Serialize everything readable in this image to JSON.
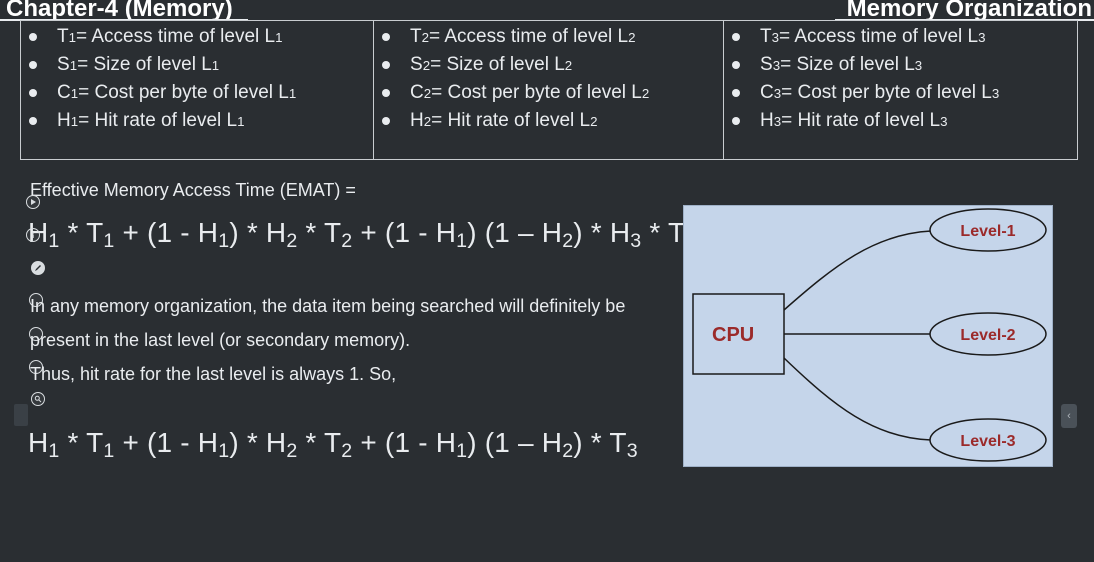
{
  "header": {
    "title_left": "Chapter-4 (Memory)",
    "title_right": "Memory Organization"
  },
  "definitions": [
    {
      "level": "1",
      "items": [
        {
          "sym": "T",
          "sub": "1",
          "text": " = Access time of level L",
          "lsub": "1"
        },
        {
          "sym": "S",
          "sub": "1",
          "text": " = Size of level L",
          "lsub": "1"
        },
        {
          "sym": "C",
          "sub": "1",
          "text": " = Cost per byte of level L",
          "lsub": "1"
        },
        {
          "sym": "H",
          "sub": "1",
          "text": " = Hit rate of level L",
          "lsub": "1"
        }
      ]
    },
    {
      "level": "2",
      "items": [
        {
          "sym": "T",
          "sub": "2",
          "text": " = Access time of level L",
          "lsub": "2"
        },
        {
          "sym": "S",
          "sub": "2",
          "text": " = Size of level L",
          "lsub": "2"
        },
        {
          "sym": "C",
          "sub": "2",
          "text": " = Cost per byte of level L",
          "lsub": "2"
        },
        {
          "sym": "H",
          "sub": "2",
          "text": " = Hit rate of level L",
          "lsub": "2"
        }
      ]
    },
    {
      "level": "3",
      "items": [
        {
          "sym": "T",
          "sub": "3",
          "text": " = Access time of level L",
          "lsub": "3"
        },
        {
          "sym": "S",
          "sub": "3",
          "text": " = Size of level L",
          "lsub": "3"
        },
        {
          "sym": "C",
          "sub": "3",
          "text": " = Cost per byte of level L",
          "lsub": "3"
        },
        {
          "sym": "H",
          "sub": "3",
          "text": " = Hit rate of level L",
          "lsub": "3"
        }
      ]
    }
  ],
  "emat_label": "Effective Memory Access Time (EMAT) =",
  "paragraph": {
    "line1": "In any memory organization, the data item being searched will definitely be",
    "line2": "present in the last level (or secondary memory).",
    "line3": "Thus, hit rate for the last level is always 1. So,"
  },
  "diagram": {
    "cpu_label": "CPU",
    "levels": [
      "Level-1",
      "Level-2",
      "Level-3"
    ],
    "colors": {
      "background": "#c5d5ea",
      "stroke": "#1a1a1a",
      "label": "#9b2a2a"
    }
  },
  "icons": [
    "play-circle-icon",
    "info-circle-icon",
    "pencil-circle-icon",
    "circle-icon",
    "circle-icon",
    "circle-icon",
    "zoom-circle-icon",
    "chevron-left-icon"
  ]
}
